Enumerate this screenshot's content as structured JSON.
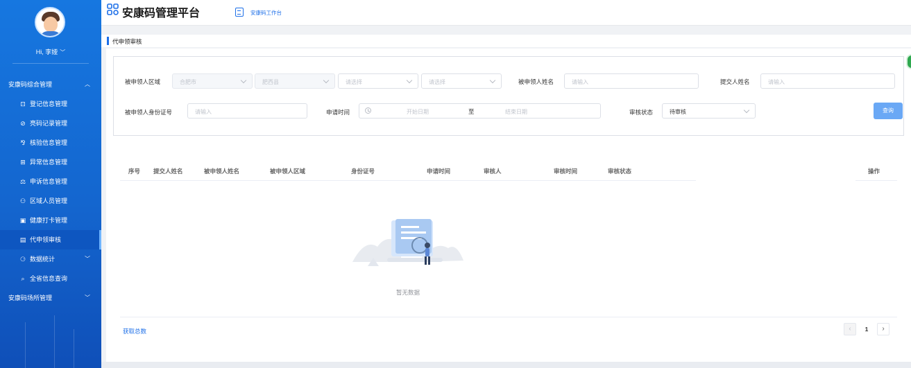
{
  "user": {
    "greeting": "Hi, 李娅",
    "chevron": "﹀"
  },
  "sidebar": {
    "groups": [
      {
        "label": "安康码综合管理",
        "arrow": "︿"
      },
      {
        "label": "安康码场所管理",
        "arrow": "﹀"
      }
    ],
    "items": [
      {
        "icon": "⊡",
        "label": "登记信息管理"
      },
      {
        "icon": "⊘",
        "label": "亮码记录管理"
      },
      {
        "icon": "⅋",
        "label": "核验信息管理"
      },
      {
        "icon": "⊞",
        "label": "异常信息管理"
      },
      {
        "icon": "⚖",
        "label": "申诉信息管理"
      },
      {
        "icon": "⚇",
        "label": "区域人员管理"
      },
      {
        "icon": "▣",
        "label": "健康打卡管理"
      },
      {
        "icon": "▤",
        "label": "代申领审核"
      },
      {
        "icon": "⚆",
        "label": "数据统计",
        "arrow": "﹀"
      },
      {
        "icon": "⌕",
        "label": "全省信息查询"
      }
    ],
    "active_item": "代申领审核"
  },
  "header": {
    "brand": "安康码管理平台",
    "workspace": "安康码工作台"
  },
  "page": {
    "title": "代申领审核"
  },
  "filters": {
    "region_label": "被申领人区域",
    "city": "合肥市",
    "county": "肥西县",
    "select_placeholder_1": "请选择",
    "select_placeholder_2": "请选择",
    "applicant_label": "被申领人姓名",
    "applicant_placeholder": "请输入",
    "submitter_label": "提交人姓名",
    "submitter_placeholder": "请输入",
    "id_label": "被申领人身份证号",
    "id_placeholder": "请输入",
    "time_label": "申请时间",
    "start_placeholder": "开始日期",
    "range_sep": "至",
    "end_placeholder": "结束日期",
    "status_label": "审核状态",
    "status_value": "待审核",
    "query_button": "查询"
  },
  "table": {
    "columns": [
      "序号",
      "提交人姓名",
      "被申领人姓名",
      "被申领人区域",
      "身份证号",
      "申请时间",
      "审核人",
      "审核时间",
      "审核状态"
    ],
    "ops_column": "操作",
    "empty_text": "暂无数据"
  },
  "footer": {
    "total_link": "获取总数",
    "current_page": "1",
    "prev": "‹",
    "next": "›"
  },
  "colors": {
    "primary": "#1d6fe8",
    "sidebar": "#1466cf",
    "button": "#6aa8f5"
  }
}
